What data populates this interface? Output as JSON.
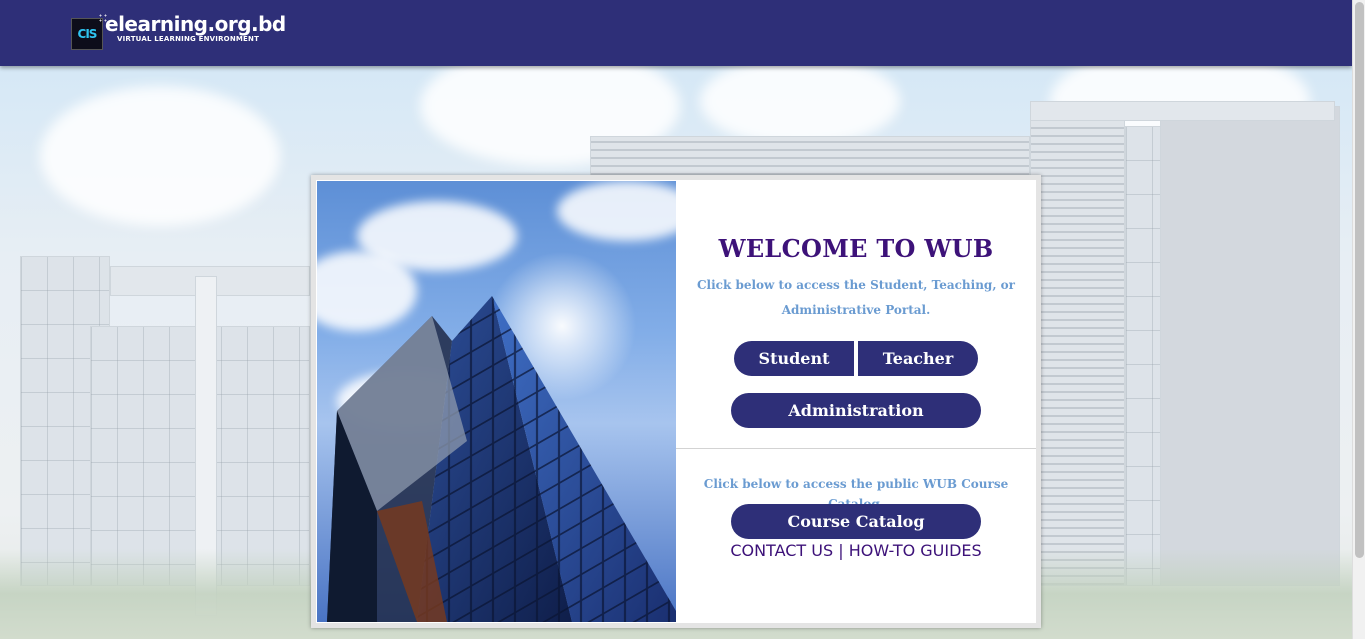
{
  "header": {
    "logo_badge": "CIS",
    "logo_title": "elearning.org.bd",
    "logo_subtitle": "VIRTUAL LEARNING ENVIRONMENT"
  },
  "welcome": {
    "title": "WELCOME TO WUB",
    "intro": "Click below to access the Student, Teaching, or Administrative Portal."
  },
  "portal_buttons": {
    "student": "Student",
    "teacher": "Teacher",
    "administration": "Administration"
  },
  "catalog": {
    "text": "Click below to access the public WUB Course Catalog.",
    "button": "Course Catalog"
  },
  "links": {
    "contact": "CONTACT US",
    "separator": "|",
    "guides": "HOW-TO GUIDES"
  },
  "colors": {
    "brand": "#2e2f78",
    "title": "#3d1279",
    "accent_text": "#6a9bd1"
  }
}
